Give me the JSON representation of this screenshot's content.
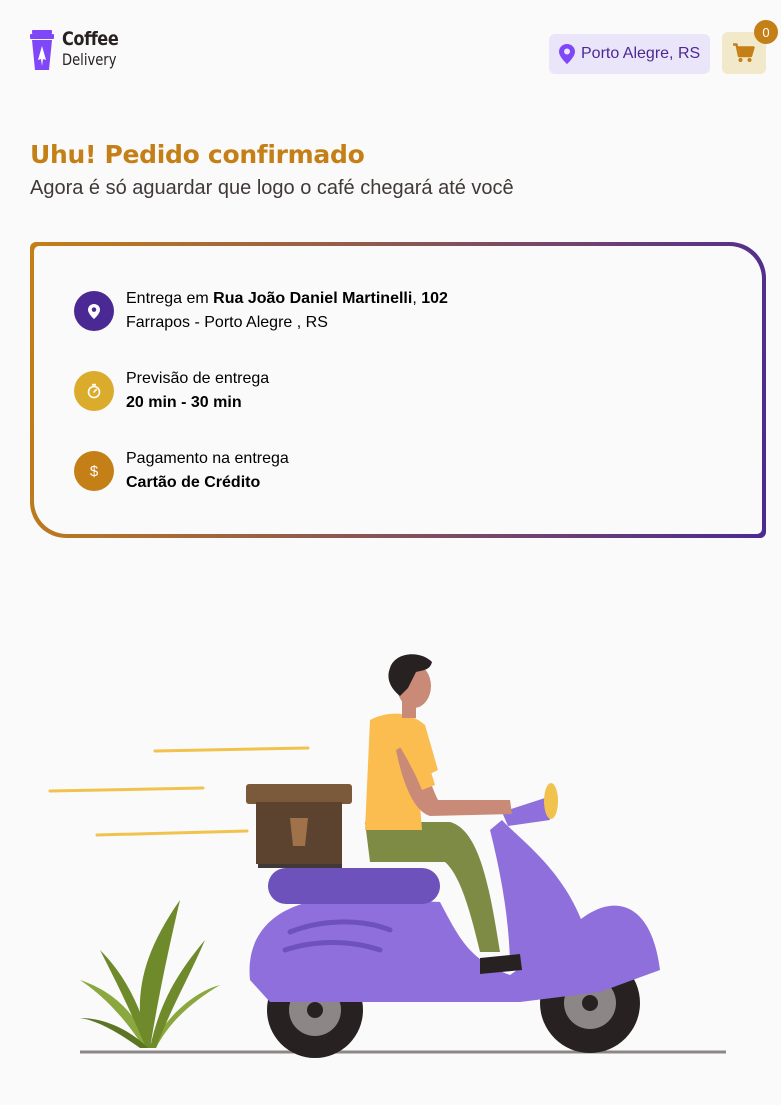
{
  "header": {
    "logo_line1": "Coffee",
    "logo_line2": "Delivery",
    "location": "Porto Alegre, RS",
    "cart_count": "0"
  },
  "main": {
    "title": "Uhu! Pedido confirmado",
    "subtitle": "Agora é só aguardar que logo o café chegará até você"
  },
  "order": {
    "delivery": {
      "prefix": "Entrega em ",
      "street": "Rua João Daniel Martinelli",
      "separator": ", ",
      "number": "102",
      "area": "Farrapos - Porto Alegre , RS"
    },
    "forecast": {
      "label": "Previsão de entrega",
      "value": "20 min - 30 min"
    },
    "payment": {
      "label": "Pagamento na entrega",
      "value": "Cartão de Crédito"
    }
  },
  "colors": {
    "brand_yellow_dark": "#c47f17",
    "brand_yellow": "#dbac2c",
    "brand_purple_dark": "#4b2995",
    "brand_purple": "#8047f8",
    "background": "#fafafa"
  },
  "icons": [
    "coffee-cup-logo-icon",
    "map-pin-icon",
    "shopping-cart-icon",
    "timer-icon",
    "currency-dollar-icon",
    "delivery-illustration"
  ]
}
